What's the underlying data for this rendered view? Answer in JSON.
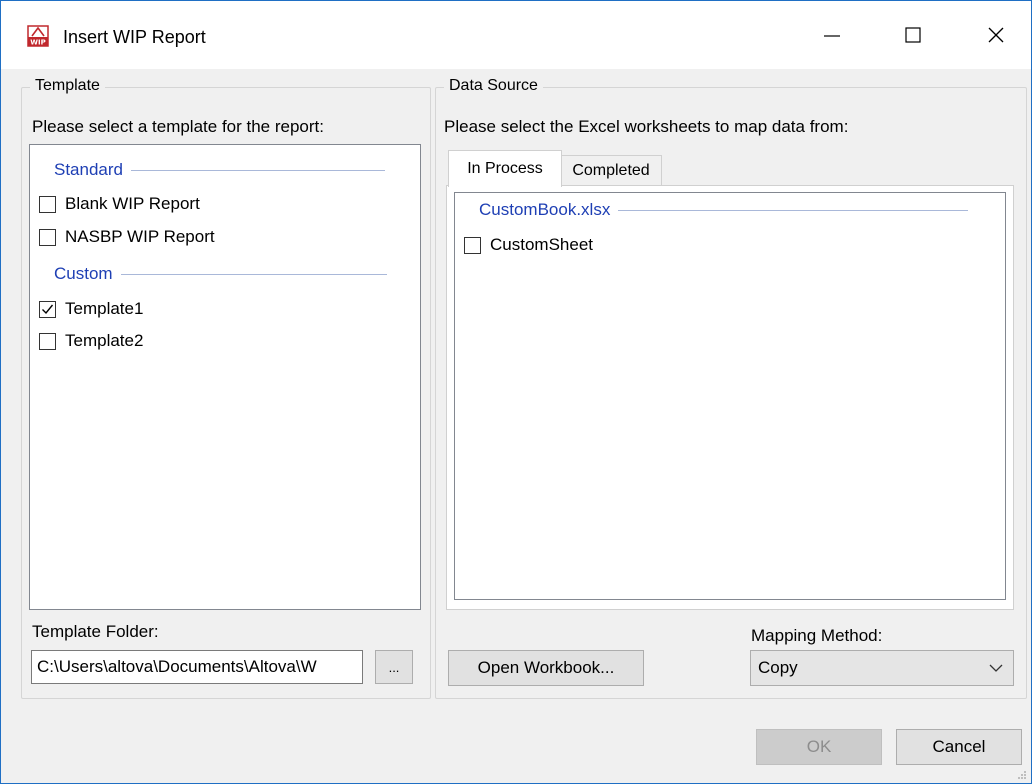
{
  "window": {
    "title": "Insert WIP Report"
  },
  "template_group": {
    "legend": "Template",
    "prompt": "Please select a template for the report:",
    "categories": [
      {
        "name": "Standard",
        "items": [
          {
            "label": "Blank WIP Report",
            "checked": false
          },
          {
            "label": "NASBP WIP Report",
            "checked": false
          }
        ]
      },
      {
        "name": "Custom",
        "items": [
          {
            "label": "Template1",
            "checked": true
          },
          {
            "label": "Template2",
            "checked": false
          }
        ]
      }
    ],
    "folder_label": "Template Folder:",
    "folder_value": "C:\\Users\\altova\\Documents\\Altova\\W",
    "browse_label": "..."
  },
  "datasource_group": {
    "legend": "Data Source",
    "prompt": "Please select the Excel worksheets to map data from:",
    "tabs": [
      {
        "label": "In Process",
        "active": true
      },
      {
        "label": "Completed",
        "active": false
      }
    ],
    "workbook": "CustomBook.xlsx",
    "sheets": [
      {
        "label": "CustomSheet",
        "checked": false
      }
    ],
    "open_workbook_label": "Open Workbook...",
    "mapping_label": "Mapping Method:",
    "mapping_value": "Copy"
  },
  "footer": {
    "ok_label": "OK",
    "cancel_label": "Cancel"
  }
}
